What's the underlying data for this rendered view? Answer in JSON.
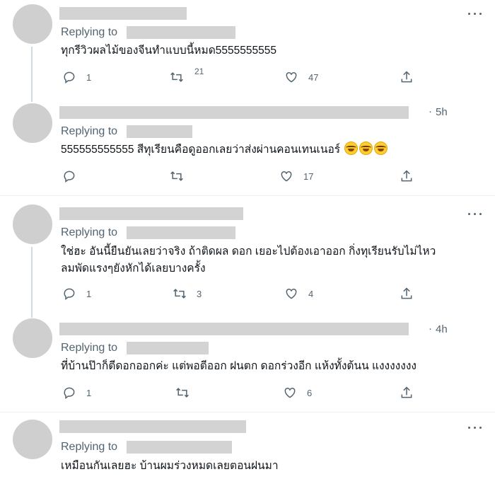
{
  "reply_prefix": "Replying to",
  "tweets": [
    {
      "text_lines": [
        "ทุกรีวิวผลไม้ของจีนทำแบบนี้หมด5555555555"
      ],
      "time": "",
      "replies": "1",
      "retweets": "21",
      "likes": "47"
    },
    {
      "text_lines": [
        "555555555555 สีทุเรียนคือดูออกเลยว่าส่งผ่านคอนเทนเนอร์"
      ],
      "time": "5h",
      "replies": "",
      "retweets": "",
      "likes": "17",
      "emoji_count": 3
    },
    {
      "text_lines": [
        "ใช่ฮะ อันนี้ยืนยันเลยว่าจริง ถ้าติดผล ดอก เยอะไปต้องเอาออก กิ่งทุเรียนรับไม่ไหว",
        "ลมพัดแรงๆยังหักได้เลยบางครั้ง"
      ],
      "time": "",
      "replies": "1",
      "retweets": "3",
      "likes": "4"
    },
    {
      "text_lines": [
        "ที่บ้านป๊าก็ตีดอกออกค่ะ แต่พอตีออก ฝนตก ดอกร่วงอีก แห้งทั้งต้นน แงงงงงงง"
      ],
      "time": "4h",
      "replies": "1",
      "retweets": "",
      "likes": "6"
    },
    {
      "text_lines": [
        "เหมือนกันเลยฮะ บ้านผมร่วงหมดเลยตอนฝนมา"
      ],
      "time": "",
      "replies": "",
      "retweets": "",
      "likes": ""
    }
  ],
  "icons": {
    "reply": "reply-icon",
    "retweet": "retweet-icon",
    "like": "heart-icon",
    "share": "share-icon",
    "more": "more-icon"
  },
  "colors": {
    "text": "#0f1419",
    "muted": "#536471",
    "redaction": "#d3d3d3"
  }
}
